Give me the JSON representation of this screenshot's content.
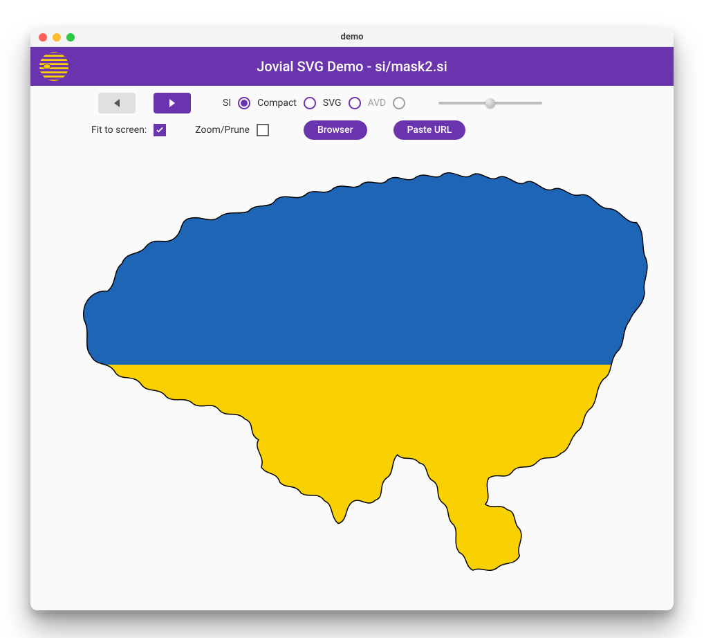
{
  "window": {
    "title": "demo"
  },
  "appbar": {
    "title": "Jovial SVG Demo - si/mask2.si"
  },
  "format": {
    "options": [
      {
        "label": "SI",
        "selected": true,
        "enabled": true
      },
      {
        "label": "Compact",
        "selected": false,
        "enabled": true
      },
      {
        "label": "SVG",
        "selected": false,
        "enabled": true
      },
      {
        "label": "AVD",
        "selected": false,
        "enabled": false
      }
    ]
  },
  "nav": {
    "prev_enabled": false,
    "next_enabled": true
  },
  "slider": {
    "value": 50
  },
  "toggles": {
    "fit_label": "Fit to screen:",
    "fit_checked": true,
    "zoom_label": "Zoom/Prune",
    "zoom_checked": false
  },
  "buttons": {
    "browser": "Browser",
    "paste_url": "Paste URL"
  },
  "colors": {
    "accent": "#6a34af",
    "flag_top": "#1e66b5",
    "flag_bottom": "#f9d000",
    "logo_yellow": "#f9d000"
  },
  "canvas": {
    "description": "Outline of Ukraine filled with the Ukrainian flag (blue top half, yellow bottom half)."
  }
}
